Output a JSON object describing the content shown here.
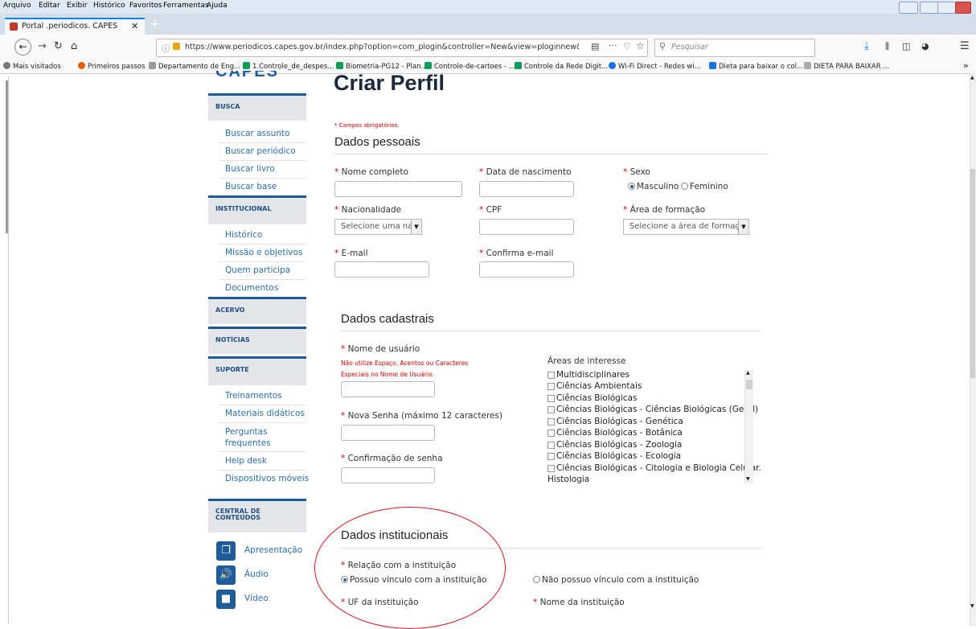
{
  "browser": {
    "menu": [
      "Arquivo",
      "Editar",
      "Exibir",
      "Histórico",
      "Favoritos",
      "Ferramentas",
      "Ajuda"
    ],
    "tab_title": "Portal .periodicos. CAPES",
    "url": "https://www.periodicos.capes.gov.br/index.php?option=com_plogin&controller=New&view=ploginnew&Item",
    "search_placeholder": "Pesquisar",
    "bookmarks": [
      {
        "label": "Mais visitados",
        "icon": "gear-icon",
        "color": "#666666"
      },
      {
        "label": "Primeiros passos",
        "icon": "firefox-icon",
        "color": "#e66000"
      },
      {
        "label": "Departamento de Eng...",
        "icon": "site-icon",
        "color": "#888888"
      },
      {
        "label": "1.Controle_de_despes...",
        "icon": "sheets-icon",
        "color": "#0f9d58"
      },
      {
        "label": "Biometria-PG12 - Plan...",
        "icon": "sheets-icon",
        "color": "#0f9d58"
      },
      {
        "label": "Controle-de-cartoes - ...",
        "icon": "sheets-icon",
        "color": "#0f9d58"
      },
      {
        "label": "Controle da Rede Digit...",
        "icon": "sheets-icon",
        "color": "#0f9d58"
      },
      {
        "label": "Wi-Fi Direct - Redes wi...",
        "icon": "site-icon",
        "color": "#1a73e8"
      },
      {
        "label": "Dieta para baixar o col...",
        "icon": "plus-icon",
        "color": "#1a73e8"
      },
      {
        "label": "DIETA PARA BAIXAR ...",
        "icon": "site-icon",
        "color": "#888888"
      }
    ]
  },
  "sidebar": {
    "logo_text": "CAPES",
    "sections": [
      {
        "title": "BUSCA",
        "links": [
          "Buscar assunto",
          "Buscar periódico",
          "Buscar livro",
          "Buscar base"
        ]
      },
      {
        "title": "INSTITUCIONAL",
        "links": [
          "Histórico",
          "Missão e objetivos",
          "Quem participa",
          "Documentos"
        ]
      },
      {
        "title": "ACERVO",
        "links": []
      },
      {
        "title": "NOTÍCIAS",
        "links": []
      },
      {
        "title": "SUPORTE",
        "links": [
          "Treinamentos",
          "Materiais didáticos",
          "Perguntas frequentes",
          "Help desk",
          "Dispositivos móveis"
        ]
      },
      {
        "title": "CENTRAL DE CONTEÚDOS",
        "links": []
      }
    ],
    "media": [
      {
        "label": "Apresentação",
        "icon": "slides-icon"
      },
      {
        "label": "Áudio",
        "icon": "speaker-icon"
      },
      {
        "label": "Vídeo",
        "icon": "video-camera-icon"
      }
    ]
  },
  "main": {
    "title": "Criar Perfil",
    "required_note": "* Campos obrigatórios.",
    "pessoais": {
      "heading": "Dados pessoais",
      "nome": "Nome completo",
      "nascimento": "Data de nascimento",
      "sexo": "Sexo",
      "sexo_options": [
        "Masculino",
        "Feminino"
      ],
      "nacionalidade": "Nacionalidade",
      "nacionalidade_value": "Selecione uma nac",
      "cpf": "CPF",
      "area_formacao": "Área de formação",
      "area_formacao_value": "Selecione a área de formação",
      "email": "E-mail",
      "confirma_email": "Confirma e-mail"
    },
    "cadastrais": {
      "heading": "Dados cadastrais",
      "usuario": "Nome de usuário",
      "warning_line1": "Não utilize Espaço, Acentos ou Caracteres",
      "warning_line2": "Especiais no Nome de Usuário.",
      "senha": "Nova Senha  (máximo 12 caracteres)",
      "confirmacao": "Confirmação de senha",
      "areas_title": "Áreas de interesse",
      "areas": [
        "Multidisciplinares",
        "Ciências Ambientais",
        "Ciências Biológicas",
        "Ciências Biológicas - Ciências Biológicas (Geral)",
        "Ciências Biológicas - Genética",
        "Ciências Biológicas - Botânica",
        "Ciências Biológicas - Zoologia",
        "Ciências Biológicas - Ecologia",
        "Ciências Biológicas - Citologia e Biologia Celular.",
        "Histologia"
      ]
    },
    "institucionais": {
      "heading": "Dados institucionais",
      "relacao": "Relação com a instituição",
      "opt_vinculo": "Possuo vínculo com a instituição",
      "opt_sem_vinculo": "Não possuo vínculo com a instituição",
      "uf": "UF da instituição",
      "nome_inst": "Nome da instituição"
    }
  },
  "colors": {
    "annotation_circle": "#e0141c",
    "accent": "#1f5c9c",
    "required": "#d00000"
  }
}
